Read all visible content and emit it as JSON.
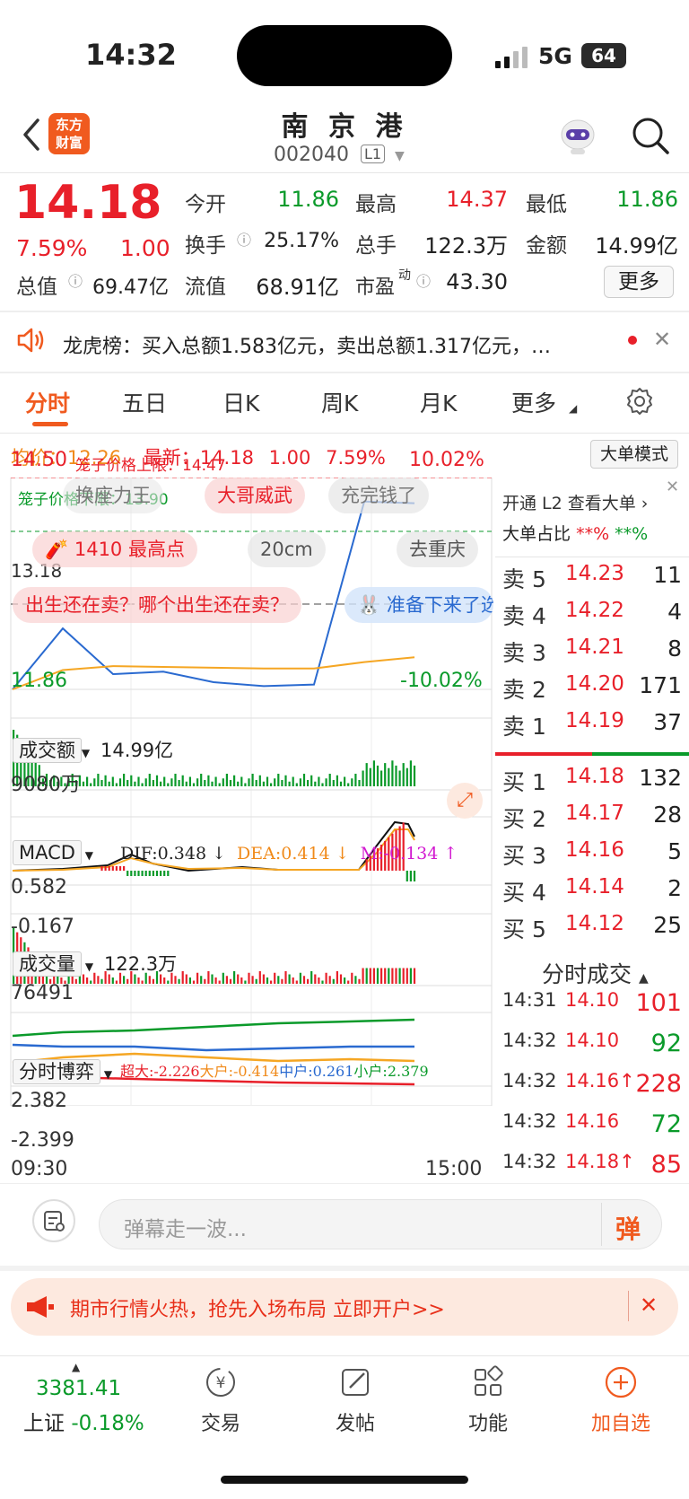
{
  "status": {
    "time": "14:32",
    "network": "5G",
    "battery": "64"
  },
  "header": {
    "logo_text_1": "东方",
    "logo_text_2": "财富",
    "name": "南 京 港",
    "code": "002040",
    "level": "L1"
  },
  "quote": {
    "price": "14.18",
    "change_pct": "7.59%",
    "change": "1.00",
    "open_label": "今开",
    "open": "11.86",
    "high_label": "最高",
    "high": "14.37",
    "low_label": "最低",
    "low": "11.86",
    "turnover_label": "换手",
    "turnover": "25.17%",
    "volume_label": "总手",
    "volume": "122.3万",
    "amount_label": "金额",
    "amount": "14.99亿",
    "total_cap_label": "总值",
    "total_cap": "69.47亿",
    "float_cap_label": "流值",
    "float_cap": "68.91亿",
    "pe_label": "市盈",
    "pe_sup": "动",
    "pe": "43.30",
    "more": "更多"
  },
  "news": {
    "text": "龙虎榜：买入总额1.583亿元，卖出总额1.317亿元，…"
  },
  "tabs": [
    "分时",
    "五日",
    "日K",
    "周K",
    "月K",
    "更多"
  ],
  "avg": {
    "avg_label": "均价：",
    "avg": "12.26",
    "latest_label": "最新：",
    "latest": "14.18",
    "chg": "1.00",
    "pct": "7.59%",
    "bigorder": "大单模式"
  },
  "chart": {
    "top_price": "14.50",
    "cage_upper": "笼子价格上限：14.47",
    "top_pct": "10.02%",
    "cage_lower": "笼子价格下限：13.90",
    "mid_price": "13.18",
    "bottom_price": "11.86",
    "bottom_pct": "-10.02%",
    "bubbles": [
      "换座力王",
      "大哥威武",
      "充完钱了",
      "1410 最高点",
      "20cm",
      "去重庆",
      "出生还在卖？哪个出生还在卖？",
      "准备下来了选"
    ],
    "amount_label": "成交额",
    "amount_value": "14.99亿",
    "amount_max": "9080万",
    "macd_label": "MACD",
    "dif": "DIF:0.348 ↓",
    "dea": "DEA:0.414 ↓",
    "m": "M:-0.134 ↑",
    "macd_top": "0.582",
    "macd_bottom": "-0.167",
    "volume_label": "成交量",
    "volume_value": "122.3万",
    "volume_max": "76491",
    "game_label": "分时博弈",
    "super": "超大:-2.226",
    "big": "大户:-0.414",
    "mid": "中户:0.261",
    "small": "小户:2.379",
    "game_top": "2.382",
    "game_bottom": "-2.399",
    "time_start": "09:30",
    "time_end": "15:00"
  },
  "chart_data": {
    "type": "line",
    "x": [
      "09:30",
      "10:00",
      "10:30",
      "11:00",
      "11:30",
      "13:30",
      "14:00",
      "14:30",
      "15:00"
    ],
    "series": [
      {
        "values": [
          11.86,
          12.62,
          12.05,
          12.08,
          11.95,
          11.9,
          11.92,
          14.2,
          14.18
        ]
      },
      {
        "values": [
          11.86,
          12.1,
          12.15,
          12.14,
          12.13,
          12.12,
          12.12,
          12.2,
          12.26
        ]
      }
    ],
    "ylim": [
      11.86,
      14.5
    ]
  },
  "panel": {
    "l2": "开通 L2 查看大单",
    "big_ratio_label": "大单占比",
    "big_ratio_a": "**%",
    "big_ratio_b": "**%",
    "asks": [
      {
        "label": "卖 5",
        "price": "14.23",
        "vol": "11"
      },
      {
        "label": "卖 4",
        "price": "14.22",
        "vol": "4"
      },
      {
        "label": "卖 3",
        "price": "14.21",
        "vol": "8"
      },
      {
        "label": "卖 2",
        "price": "14.20",
        "vol": "171"
      },
      {
        "label": "卖 1",
        "price": "14.19",
        "vol": "37"
      }
    ],
    "bids": [
      {
        "label": "买 1",
        "price": "14.18",
        "vol": "132"
      },
      {
        "label": "买 2",
        "price": "14.17",
        "vol": "28"
      },
      {
        "label": "买 3",
        "price": "14.16",
        "vol": "5"
      },
      {
        "label": "买 4",
        "price": "14.14",
        "vol": "2"
      },
      {
        "label": "买 5",
        "price": "14.12",
        "vol": "25"
      }
    ],
    "trades_title": "分时成交",
    "trades": [
      {
        "time": "14:31",
        "price": "14.10",
        "vol": "101",
        "color": "#e8202a"
      },
      {
        "time": "14:32",
        "price": "14.10",
        "vol": "92",
        "color": "#0a9a2a"
      },
      {
        "time": "14:32",
        "price": "14.16↑",
        "vol": "228",
        "color": "#e8202a"
      },
      {
        "time": "14:32",
        "price": "14.16",
        "vol": "72",
        "color": "#0a9a2a"
      },
      {
        "time": "14:32",
        "price": "14.18↑",
        "vol": "85",
        "color": "#e8202a"
      }
    ]
  },
  "comment": {
    "placeholder": "弹幕走一波...",
    "button": "弹"
  },
  "promo": {
    "text": "期市行情火热，抢先入场布局 立即开户>>"
  },
  "nav": {
    "index_value": "3381.41",
    "index_name": "上证",
    "index_pct": "-0.18%",
    "items": [
      "交易",
      "发帖",
      "功能",
      "加自选"
    ]
  }
}
